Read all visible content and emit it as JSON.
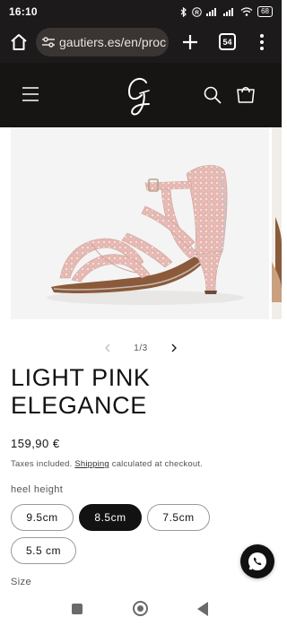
{
  "status_bar": {
    "time": "16:10",
    "battery": "68",
    "icons": [
      "bluetooth-icon",
      "r-icon",
      "signal-icon",
      "signal-icon",
      "wifi-icon",
      "battery-icon"
    ]
  },
  "browser": {
    "url": "gautiers.es/en/proc",
    "tab_count": "54",
    "icons": [
      "home-icon",
      "site-settings-icon",
      "plus-icon",
      "tabs-icon",
      "more-vert-icon"
    ]
  },
  "header": {
    "logo_letter": "G",
    "icons": [
      "hamburger-menu-icon",
      "search-icon",
      "cart-icon"
    ]
  },
  "gallery": {
    "counter": "1/3",
    "icons": [
      "chevron-left-icon",
      "chevron-right-icon"
    ]
  },
  "product": {
    "title": "LIGHT PINK ELEGANCE",
    "price": "159,90 €",
    "tax_prefix": "Taxes included.",
    "shipping_link": "Shipping",
    "tax_suffix": "calculated at checkout.",
    "option_label": "heel height",
    "heel_options": [
      {
        "label": "9.5cm",
        "selected": false
      },
      {
        "label": "8.5cm",
        "selected": true
      },
      {
        "label": "7.5cm",
        "selected": false
      },
      {
        "label": "5.5 cm",
        "selected": false
      }
    ],
    "size_label": "Size"
  },
  "colors": {
    "header_bg": "#171414",
    "browser_bg": "#1c1a1a",
    "selected_pill": "#121212",
    "shoe_pink": "#e7b7b0"
  },
  "floating": {
    "icon": "whatsapp-icon"
  },
  "nav_bar": {
    "icons": [
      "recents-icon",
      "home-circle-icon",
      "back-icon"
    ]
  }
}
